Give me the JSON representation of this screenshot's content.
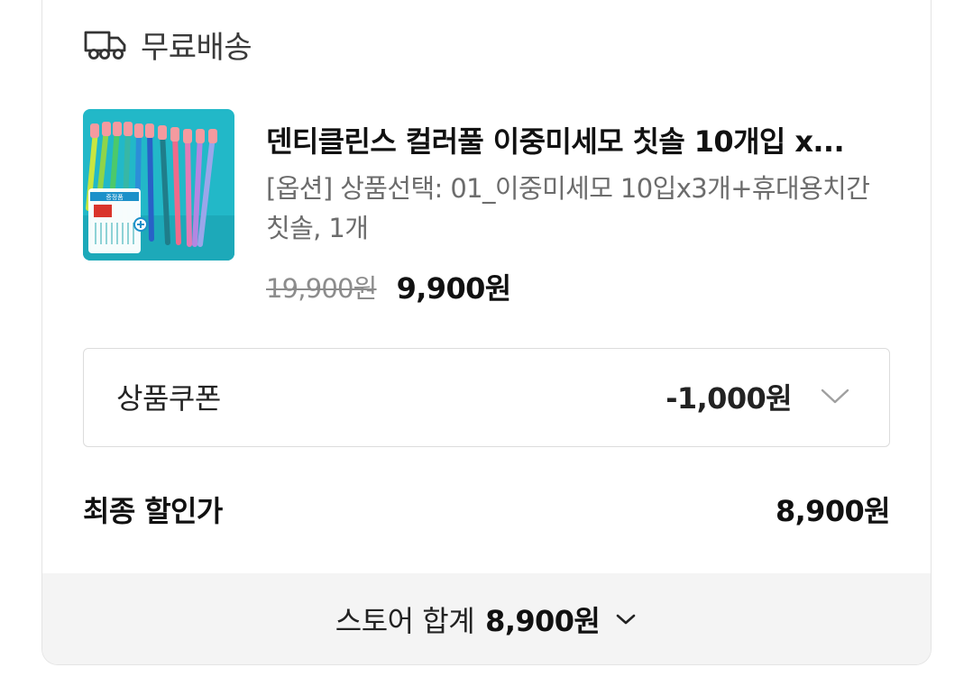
{
  "shipping": {
    "label": "무료배송",
    "icon": "truck-icon"
  },
  "product": {
    "title": "덴티클린스 컬러풀 이중미세모 칫솔 10개입 x...",
    "option": "[옵션] 상품선택: 01_이중미세모 10입x3개+휴대용치간칫솔, 1개",
    "original_price": "19,900원",
    "sale_price": "9,900원",
    "thumbnail_badge": "증정품"
  },
  "coupon": {
    "label": "상품쿠폰",
    "amount": "-1,000원",
    "icon": "chevron-down-icon"
  },
  "final": {
    "label": "최종 할인가",
    "amount": "8,900원"
  },
  "store_total": {
    "label": "스토어 합계",
    "amount": "8,900원",
    "icon": "chevron-down-icon"
  },
  "colors": {
    "thumbnail_bg": "#22b8c8",
    "border": "#dcdcdc",
    "footer_bg": "#f4f4f4",
    "strike_text": "#8c8c8c"
  }
}
